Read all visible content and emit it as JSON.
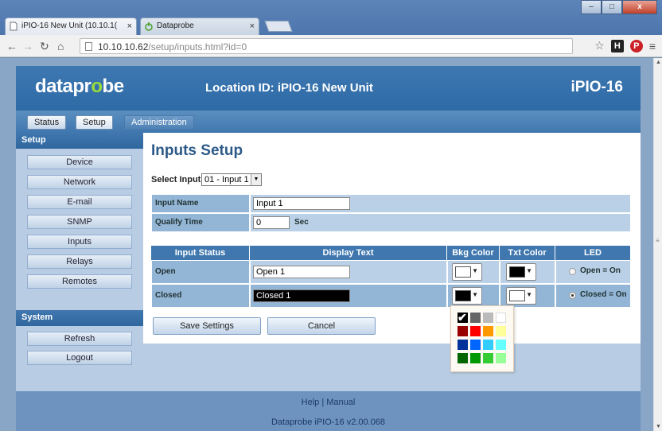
{
  "browser": {
    "tabs": [
      {
        "title": "iPIO-16 New Unit (10.10.1(",
        "close": "×"
      },
      {
        "title": "Dataprobe",
        "close": "×"
      }
    ],
    "url_host": "10.10.10.62",
    "url_path": "/setup/inputs.html?id=0",
    "window_controls": [
      "–",
      "□",
      "x"
    ],
    "extensions": {
      "h": "H",
      "p": "P"
    }
  },
  "header": {
    "logo_prefix": "datapr",
    "logo_o": "o",
    "logo_suffix": "be",
    "location": "Location ID: iPIO-16 New Unit",
    "model": "iPIO-16"
  },
  "topnav": {
    "status": "Status",
    "setup": "Setup",
    "administration": "Administration"
  },
  "sidebar": {
    "setup_heading": "Setup",
    "setup_items": [
      "Device",
      "Network",
      "E-mail",
      "SNMP",
      "Inputs",
      "Relays",
      "Remotes"
    ],
    "system_heading": "System",
    "system_items": [
      "Refresh",
      "Logout"
    ]
  },
  "main": {
    "title": "Inputs Setup",
    "select_label": "Select Input",
    "select_value": "01 - Input 1",
    "input_name_label": "Input Name",
    "input_name_value": "Input 1",
    "qualify_label": "Qualify Time",
    "qualify_value": "0",
    "qualify_unit": "Sec",
    "status_headers": [
      "Input Status",
      "Display Text",
      "Bkg Color",
      "Txt Color",
      "LED"
    ],
    "rows": [
      {
        "status": "Open",
        "text": "Open 1",
        "bkg": "#ffffff",
        "txt": "#000000",
        "led": "Open = On",
        "led_on": false,
        "input_bg": "#ffffff",
        "input_fg": "#000000"
      },
      {
        "status": "Closed",
        "text": "Closed 1",
        "bkg": "#000000",
        "txt": "#ffffff",
        "led": "Closed = On",
        "led_on": true,
        "input_bg": "#000000",
        "input_fg": "#ffffff"
      }
    ],
    "save_label": "Save Settings",
    "cancel_label": "Cancel"
  },
  "palette": {
    "selected": "#000000",
    "colors": [
      [
        "#000000",
        "#666666",
        "#bbbbbb",
        "#ffffff"
      ],
      [
        "#990000",
        "#ff0000",
        "#ff9900",
        "#ffff99"
      ],
      [
        "#003399",
        "#0066ff",
        "#33ccff",
        "#66ffff"
      ],
      [
        "#006600",
        "#009900",
        "#33cc33",
        "#99ff99"
      ]
    ]
  },
  "footer": {
    "help": "Help",
    "separator": "|",
    "manual": "Manual",
    "version": "Dataprobe iPIO-16 v2.00.068"
  }
}
